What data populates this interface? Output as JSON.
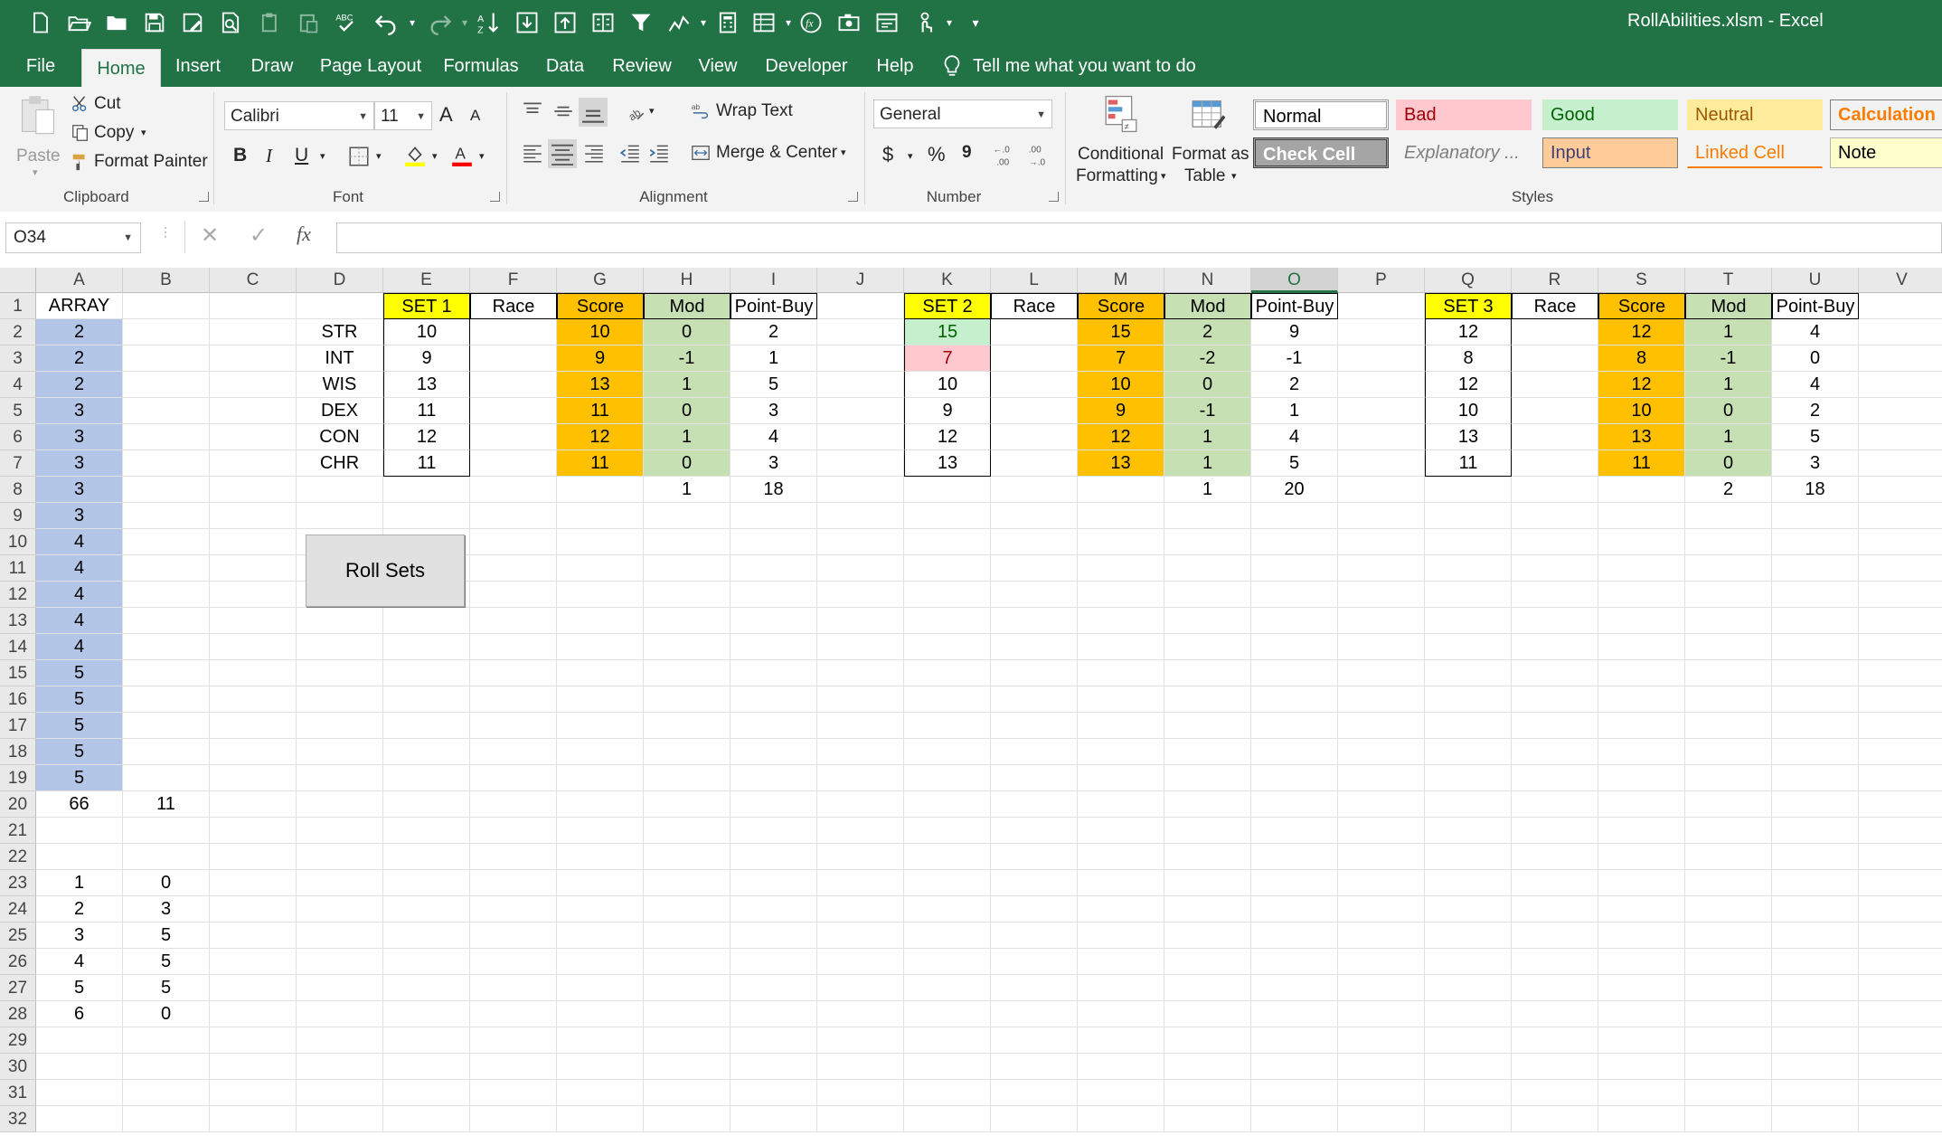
{
  "window": {
    "title": "RollAbilities.xlsm  -  Excel"
  },
  "qat": [
    "new-file",
    "open",
    "open-folder",
    "save",
    "save-as",
    "print-preview",
    "paste",
    "paste-special",
    "spelling",
    "undo",
    "redo",
    "sort",
    "import",
    "export",
    "text-columns",
    "filter",
    "chart",
    "calculator",
    "form",
    "formula",
    "camera",
    "macro",
    "touch",
    "customize"
  ],
  "tabs": [
    "File",
    "Home",
    "Insert",
    "Draw",
    "Page Layout",
    "Formulas",
    "Data",
    "Review",
    "View",
    "Developer",
    "Help"
  ],
  "tell_me": "Tell me what you want to do",
  "ribbon": {
    "clipboard": {
      "paste": "Paste",
      "cut": "Cut",
      "copy": "Copy",
      "format_painter": "Format Painter",
      "label": "Clipboard"
    },
    "font": {
      "name": "Calibri",
      "size": "11",
      "bold": "B",
      "italic": "I",
      "underline": "U",
      "grow": "A",
      "shrink": "A",
      "label": "Font",
      "fill_color": "#ffff00",
      "font_color": "#ff0000"
    },
    "alignment": {
      "wrap": "Wrap Text",
      "merge": "Merge & Center",
      "label": "Alignment"
    },
    "number": {
      "format": "General",
      "currency": "$",
      "percent": "%",
      "comma": "9",
      "inc_decimal": "←.0\n.00",
      "label": "Number"
    },
    "styles": {
      "conditional": [
        "Conditional",
        "Formatting"
      ],
      "format_table": [
        "Format as",
        "Table"
      ],
      "label": "Styles",
      "items": [
        {
          "name": "Normal",
          "bg": "#ffffff",
          "fg": "#000000",
          "border": "#9b9b9b"
        },
        {
          "name": "Bad",
          "bg": "#ffc7ce",
          "fg": "#9c0006",
          "border": "#ffc7ce"
        },
        {
          "name": "Good",
          "bg": "#c6efce",
          "fg": "#006100",
          "border": "#c6efce"
        },
        {
          "name": "Neutral",
          "bg": "#ffeb9c",
          "fg": "#9c5700",
          "border": "#ffeb9c"
        },
        {
          "name": "Calculation",
          "bg": "#f2f2f2",
          "fg": "#fa7d00",
          "border": "#7f7f7f"
        },
        {
          "name": "Check Cell",
          "bg": "#a5a5a5",
          "fg": "#ffffff",
          "border": "#3f3f3f"
        },
        {
          "name": "Explanatory ...",
          "bg": "#f3f3f3",
          "fg": "#7f7f7f",
          "border": "#f3f3f3"
        },
        {
          "name": "Input",
          "bg": "#ffcc99",
          "fg": "#3f3f76",
          "border": "#7f7f7f"
        },
        {
          "name": "Linked Cell",
          "bg": "#f3f3f3",
          "fg": "#fa7d00",
          "border": "#f3f3f3"
        },
        {
          "name": "Note",
          "bg": "#ffffcc",
          "fg": "#000000",
          "border": "#b2b2b2"
        }
      ]
    }
  },
  "formula_bar": {
    "name_box": "O34",
    "cancel": "✕",
    "enter": "✓",
    "fx": "fx",
    "value": ""
  },
  "grid": {
    "columns": [
      "A",
      "B",
      "C",
      "D",
      "E",
      "F",
      "G",
      "H",
      "I",
      "J",
      "K",
      "L",
      "M",
      "N",
      "O",
      "P",
      "Q",
      "R",
      "S",
      "T",
      "U",
      "V"
    ],
    "selected_column": "O",
    "rows": [
      "1",
      "2",
      "3",
      "4",
      "5",
      "6",
      "7",
      "8",
      "9",
      "10",
      "11",
      "12",
      "13",
      "14",
      "15",
      "16",
      "17",
      "18",
      "19",
      "20",
      "21",
      "22",
      "23",
      "24",
      "25",
      "26",
      "27",
      "28",
      "29",
      "30",
      "31",
      "32"
    ],
    "colors": {
      "array": "#b4c6e7",
      "set_header": "#ffff00",
      "score": "#ffc000",
      "mod": "#c6e0b4",
      "good": "#c6efce",
      "bad": "#ffc7ce"
    },
    "header_row": {
      "A": "ARRAY",
      "E": "SET 1",
      "F": "Race",
      "G": "Score",
      "H": "Mod",
      "I": "Point-Buy",
      "K": "SET 2",
      "L": "Race",
      "M": "Score",
      "N": "Mod",
      "O": "Point-Buy",
      "Q": "SET 3",
      "R": "Race",
      "S": "Score",
      "T": "Mod",
      "U": "Point-Buy"
    },
    "stats": [
      "STR",
      "INT",
      "WIS",
      "DEX",
      "CON",
      "CHR"
    ],
    "set1": {
      "roll": [
        "10",
        "9",
        "13",
        "11",
        "12",
        "11"
      ],
      "score": [
        "10",
        "9",
        "13",
        "11",
        "12",
        "11"
      ],
      "mod": [
        "0",
        "-1",
        "1",
        "0",
        "1",
        "0"
      ],
      "pb": [
        "2",
        "1",
        "5",
        "3",
        "4",
        "3"
      ],
      "mod_total": "1",
      "pb_total": "18"
    },
    "set2": {
      "roll": [
        "15",
        "7",
        "10",
        "9",
        "12",
        "13"
      ],
      "score": [
        "15",
        "7",
        "10",
        "9",
        "12",
        "13"
      ],
      "mod": [
        "2",
        "-2",
        "0",
        "-1",
        "1",
        "1"
      ],
      "pb": [
        "9",
        "-1",
        "2",
        "1",
        "4",
        "5"
      ],
      "mod_total": "1",
      "pb_total": "20"
    },
    "set3": {
      "roll": [
        "12",
        "8",
        "12",
        "10",
        "13",
        "11"
      ],
      "score": [
        "12",
        "8",
        "12",
        "10",
        "13",
        "11"
      ],
      "mod": [
        "1",
        "-1",
        "1",
        "0",
        "1",
        "0"
      ],
      "pb": [
        "4",
        "0",
        "4",
        "2",
        "5",
        "3"
      ],
      "mod_total": "2",
      "pb_total": "18"
    },
    "array": [
      "2",
      "2",
      "2",
      "3",
      "3",
      "3",
      "3",
      "3",
      "4",
      "4",
      "4",
      "4",
      "4",
      "5",
      "5",
      "5",
      "5",
      "5"
    ],
    "row20": {
      "A": "66",
      "B": "11"
    },
    "freq": {
      "A": [
        "1",
        "2",
        "3",
        "4",
        "5",
        "6"
      ],
      "B": [
        "0",
        "3",
        "5",
        "5",
        "5",
        "0"
      ]
    },
    "button": "Roll Sets"
  }
}
